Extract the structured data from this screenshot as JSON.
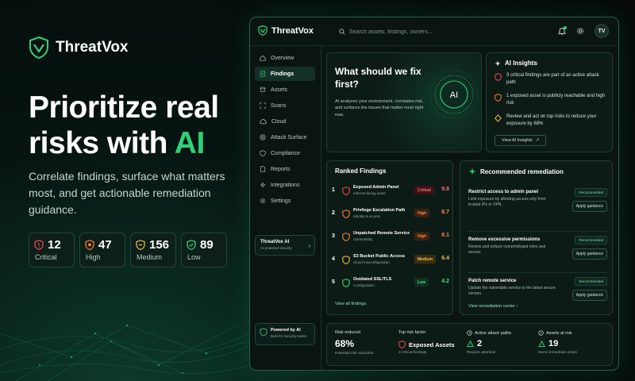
{
  "brand": {
    "name": "ThreatVox"
  },
  "hero": {
    "headline_line1": "Prioritize real",
    "headline_line2_prefix": "risks with ",
    "headline_line2_accent": "AI",
    "subcopy": "Correlate findings, surface what matters most, and get actionable remediation guidance."
  },
  "stats": [
    {
      "value": "12",
      "label": "Critical",
      "color": "#e5484d"
    },
    {
      "value": "47",
      "label": "High",
      "color": "#f07a2a"
    },
    {
      "value": "156",
      "label": "Medium",
      "color": "#e9b33c"
    },
    {
      "value": "89",
      "label": "Low",
      "color": "#2fd07b"
    }
  ],
  "app": {
    "brand": "ThreatVox",
    "search_placeholder": "Search assets, findings, owners...",
    "avatar": "TV",
    "nav": [
      "Overview",
      "Findings",
      "Assets",
      "Scans",
      "Cloud",
      "Attack Surface",
      "Compliance",
      "Reports",
      "Integrations",
      "Settings"
    ],
    "ai_card": {
      "title": "ThreatVox AI",
      "subtitle": "AI-powered security"
    },
    "powered": {
      "title": "Powered by AI",
      "subtitle": "Built for security teams"
    },
    "hero_panel": {
      "question": "What should we fix first?",
      "description": "AI analyzes your environment, correlates risk, and surfaces the issues that matter most right now.",
      "orb_label": "AI"
    },
    "insights": {
      "title": "AI Insights",
      "items": [
        "3 critical findings are part of an active attack path",
        "1 exposed asset is publicly reachable and high risk",
        "Review and act on top risks to reduce your exposure by 68%"
      ],
      "button": "View AI Insights"
    },
    "ranked": {
      "title": "Ranked Findings",
      "rows": [
        {
          "num": "1",
          "title": "Exposed Admin Panel",
          "sub": "Internet-facing asset",
          "severity": "Critical",
          "score": "9.8"
        },
        {
          "num": "2",
          "title": "Privilege Escalation Path",
          "sub": "Identity & access",
          "severity": "High",
          "score": "8.7"
        },
        {
          "num": "3",
          "title": "Unpatched Remote Service",
          "sub": "Vulnerability",
          "severity": "High",
          "score": "8.1"
        },
        {
          "num": "4",
          "title": "S3 Bucket Public Access",
          "sub": "Cloud misconfiguration",
          "severity": "Medium",
          "score": "6.4"
        },
        {
          "num": "5",
          "title": "Outdated SSL/TLS",
          "sub": "Configuration",
          "severity": "Low",
          "score": "4.2"
        }
      ],
      "link": "View all findings"
    },
    "remediation": {
      "title": "Recommended remediation",
      "items": [
        {
          "title": "Restrict access to admin panel",
          "desc": "Limit exposure by allowing access only from trusted IPs or VPN.",
          "badge": "Recommended",
          "button": "Apply guidance"
        },
        {
          "title": "Remove excessive permissions",
          "desc": "Review and reduce overprivileged roles and access.",
          "badge": "Recommended",
          "button": "Apply guidance"
        },
        {
          "title": "Patch remote service",
          "desc": "Update the vulnerable service to the latest secure version.",
          "badge": "Recommended",
          "button": "Apply guidance"
        }
      ],
      "link": "View remediation center"
    },
    "kpis": [
      {
        "label": "Risk reduced",
        "value": "68%",
        "sub": "Potential risk reduction"
      },
      {
        "label": "Top risk factor",
        "value": "Exposed Assets",
        "sub": "3 critical findings"
      },
      {
        "label": "Active attack paths",
        "value": "2",
        "sub": "Require attention"
      },
      {
        "label": "Assets at risk",
        "value": "19",
        "sub": "Need immediate action"
      }
    ]
  },
  "colors": {
    "accent": "#2fd07b",
    "critical": "#e5484d",
    "high": "#f07a2a",
    "medium": "#e9b33c",
    "low": "#2fd07b"
  }
}
